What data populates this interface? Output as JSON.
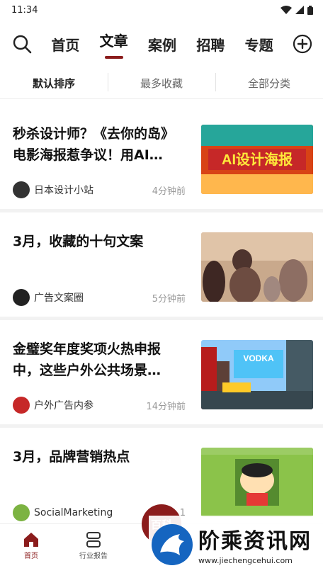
{
  "status_bar": {
    "time": "11:34"
  },
  "nav": {
    "tabs": [
      {
        "label": "首页"
      },
      {
        "label": "文章"
      },
      {
        "label": "案例"
      },
      {
        "label": "招聘"
      },
      {
        "label": "专题"
      }
    ],
    "active_tab": "文章",
    "accent": "#8b1c1c"
  },
  "sort": {
    "options": [
      {
        "label": "默认排序"
      },
      {
        "label": "最多收藏"
      },
      {
        "label": "全部分类"
      }
    ]
  },
  "articles": [
    {
      "title": "秒杀设计师？《去你的岛》电影海报惹争议！用AI…",
      "source": "日本设计小站",
      "time": "4分钟前",
      "avatar_color": "#333333",
      "thumb_text": "AI设计海报"
    },
    {
      "title": "3月，收藏的十句文案",
      "source": "广告文案圈",
      "time": "5分钟前",
      "avatar_color": "#222222",
      "thumb_text": ""
    },
    {
      "title": "金璧奖年度奖项火热申报中，这些户外公共场景…",
      "source": "户外广告内参",
      "time": "14分钟前",
      "avatar_color": "#c62828",
      "thumb_text": "VODKA"
    },
    {
      "title": "3月，品牌营销热点",
      "source": "SocialMarketing",
      "time": "1",
      "avatar_color": "#7cb342",
      "thumb_text": ""
    }
  ],
  "bottom_nav": {
    "items": [
      {
        "label": "首页"
      },
      {
        "label": "行业报告"
      }
    ]
  },
  "float_badge": {
    "label": "百科"
  },
  "watermark": {
    "brand": "阶乘资讯网",
    "url": "www.jiechengcehui.com"
  }
}
